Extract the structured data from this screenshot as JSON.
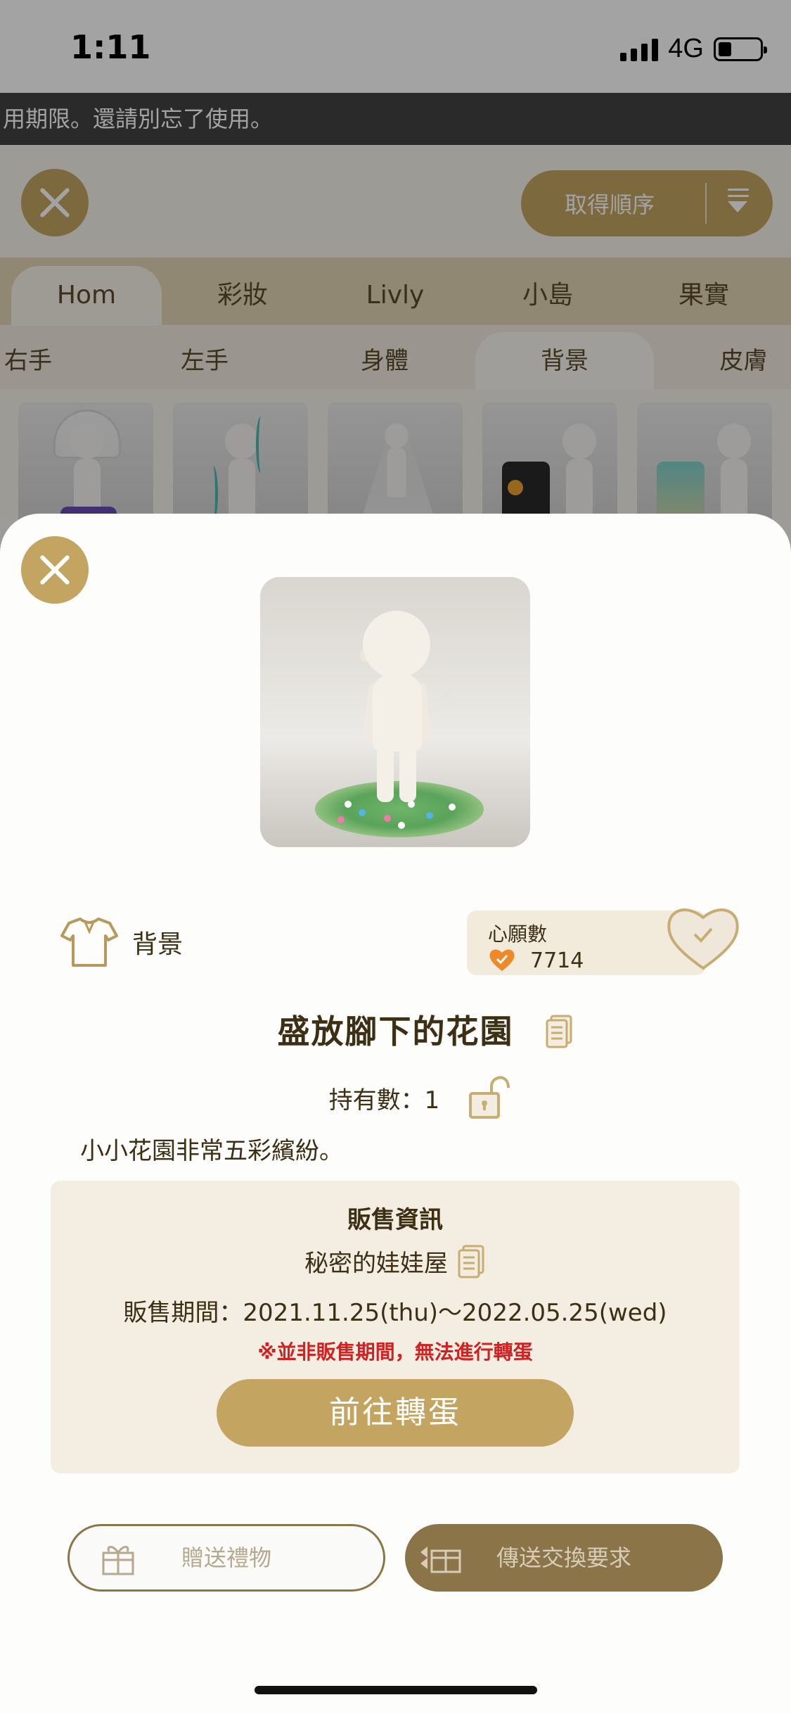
{
  "status_bar": {
    "time": "1:11",
    "network": "4G"
  },
  "marquee": "用期限。還請別忘了使用。",
  "toolbar": {
    "sort_label": "取得順序"
  },
  "category_tabs": [
    "Hom",
    "彩妝",
    "Livly",
    "小島",
    "果實"
  ],
  "sub_tabs": [
    "右手",
    "左手",
    "身體",
    "背景",
    "皮膚"
  ],
  "item": {
    "category_label": "背景",
    "wish_label": "心願數",
    "wish_count": "7714",
    "name": "盛放腳下的花園",
    "owned": "持有數：1",
    "description": "小小花園非常五彩繽紛。"
  },
  "sale": {
    "title": "販售資訊",
    "shop": "秘密的娃娃屋",
    "period": "販售期間：2021.11.25(thu)～2022.05.25(wed)",
    "warning": "※並非販售期間，無法進行轉蛋",
    "gacha_button": "前往轉蛋"
  },
  "actions": {
    "gift": "贈送禮物",
    "trade": "傳送交換要求"
  },
  "colors": {
    "accent": "#c4a461",
    "dark_accent": "#8b7448",
    "warning": "#d32020"
  }
}
